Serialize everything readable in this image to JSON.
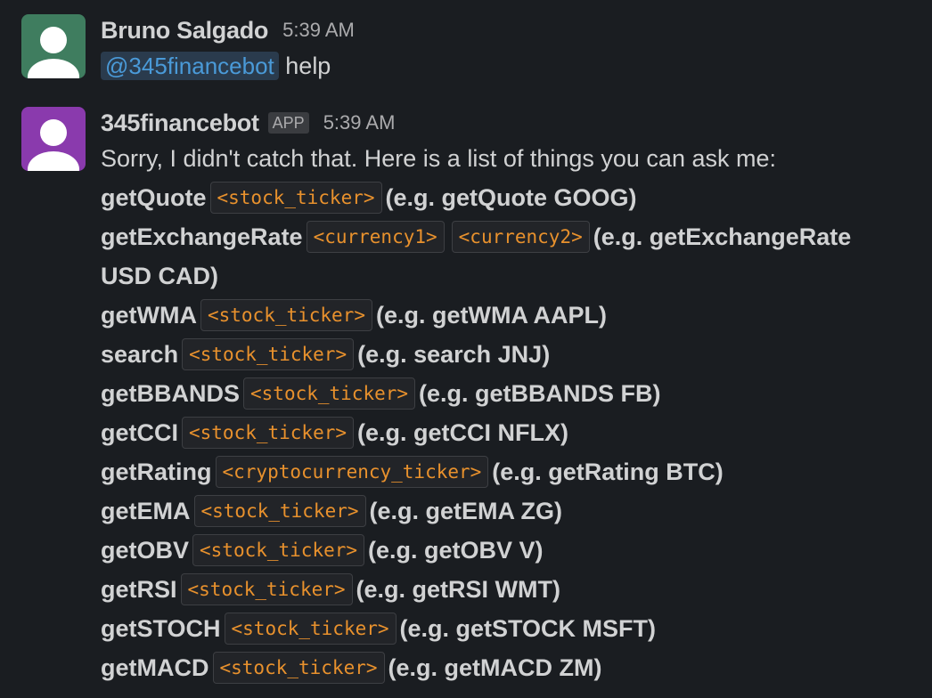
{
  "messages": [
    {
      "sender": "Bruno Salgado",
      "time": "5:39 AM",
      "mention": "@345financebot",
      "text": "help"
    },
    {
      "sender": "345financebot",
      "badge": "APP",
      "time": "5:39 AM",
      "intro": "Sorry, I didn't catch that. Here is a list of things you can ask me:",
      "commands": [
        {
          "name": "getQuote",
          "args": [
            "<stock_ticker>"
          ],
          "example": "(e.g. getQuote GOOG)"
        },
        {
          "name": "getExchangeRate",
          "args": [
            "<currency1>",
            "<currency2>"
          ],
          "example": "(e.g. getExchangeRate",
          "example_wrap": "USD CAD)"
        },
        {
          "name": "getWMA",
          "args": [
            "<stock_ticker>"
          ],
          "example": "(e.g. getWMA AAPL)"
        },
        {
          "name": "search",
          "args": [
            "<stock_ticker>"
          ],
          "example": "(e.g. search JNJ)"
        },
        {
          "name": "getBBANDS",
          "args": [
            "<stock_ticker>"
          ],
          "example": "(e.g. getBBANDS FB)"
        },
        {
          "name": "getCCI",
          "args": [
            "<stock_ticker>"
          ],
          "example": "(e.g. getCCI NFLX)"
        },
        {
          "name": "getRating",
          "args": [
            "<cryptocurrency_ticker>"
          ],
          "example": "(e.g. getRating BTC)"
        },
        {
          "name": "getEMA",
          "args": [
            "<stock_ticker>"
          ],
          "example": "(e.g. getEMA ZG)"
        },
        {
          "name": "getOBV",
          "args": [
            "<stock_ticker>"
          ],
          "example": "(e.g. getOBV V)"
        },
        {
          "name": "getRSI",
          "args": [
            "<stock_ticker>"
          ],
          "example": "(e.g. getRSI WMT)"
        },
        {
          "name": "getSTOCH",
          "args": [
            "<stock_ticker>"
          ],
          "example": "(e.g. getSTOCK MSFT)"
        },
        {
          "name": "getMACD",
          "args": [
            "<stock_ticker>"
          ],
          "example": "(e.g. getMACD ZM)"
        }
      ]
    }
  ],
  "colors": {
    "background": "#1a1d21",
    "user_avatar": "#3f7d5f",
    "bot_avatar": "#8a3aad",
    "code_text": "#e8912d",
    "mention_text": "#4a9ad8"
  }
}
